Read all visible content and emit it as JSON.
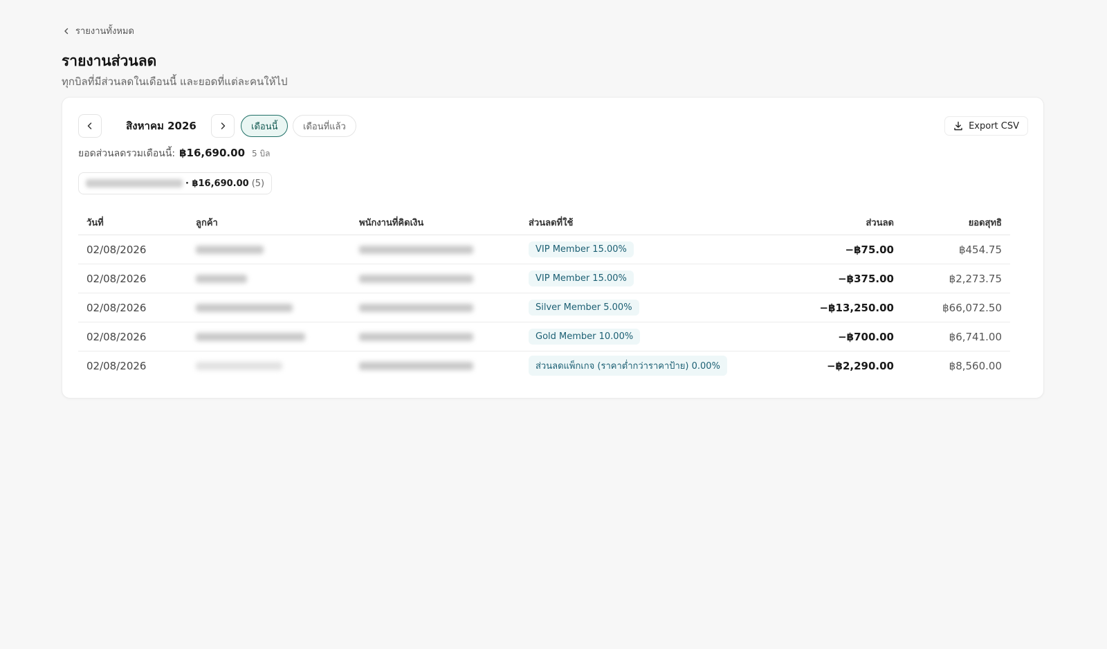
{
  "breadcrumb": {
    "label": "รายงานทั้งหมด"
  },
  "page": {
    "title": "รายงานส่วนลด",
    "subtitle": "ทุกบิลที่มีส่วนลดในเดือนนี้ และยอดที่แต่ละคนให้ไป"
  },
  "toolbar": {
    "month": "สิงหาคม 2026",
    "this_month": "เดือนนี้",
    "last_month": "เดือนที่แล้ว",
    "export": "Export CSV"
  },
  "summary": {
    "label": "ยอดส่วนลดรวมเดือนนี้:",
    "amount": "฿16,690.00",
    "count": "5 บิล"
  },
  "chip": {
    "amount": "· ฿16,690.00",
    "count": "(5)"
  },
  "table": {
    "headers": {
      "date": "วันที่",
      "customer": "ลูกค้า",
      "cashier": "พนักงานที่คิดเงิน",
      "discount_used": "ส่วนลดที่ใช้",
      "discount": "ส่วนลด",
      "net": "ยอดสุทธิ"
    },
    "rows": [
      {
        "date": "02/08/2026",
        "discount_used": "VIP Member 15.00%",
        "discount": "−฿75.00",
        "net": "฿454.75"
      },
      {
        "date": "02/08/2026",
        "discount_used": "VIP Member 15.00%",
        "discount": "−฿375.00",
        "net": "฿2,273.75"
      },
      {
        "date": "02/08/2026",
        "discount_used": "Silver Member 5.00%",
        "discount": "−฿13,250.00",
        "net": "฿66,072.50"
      },
      {
        "date": "02/08/2026",
        "discount_used": "Gold Member 10.00%",
        "discount": "−฿700.00",
        "net": "฿6,741.00"
      },
      {
        "date": "02/08/2026",
        "discount_used": "ส่วนลดแพ็กเกจ (ราคาต่ำกว่าราคาป้าย) 0.00%",
        "discount": "−฿2,290.00",
        "net": "฿8,560.00"
      }
    ]
  }
}
